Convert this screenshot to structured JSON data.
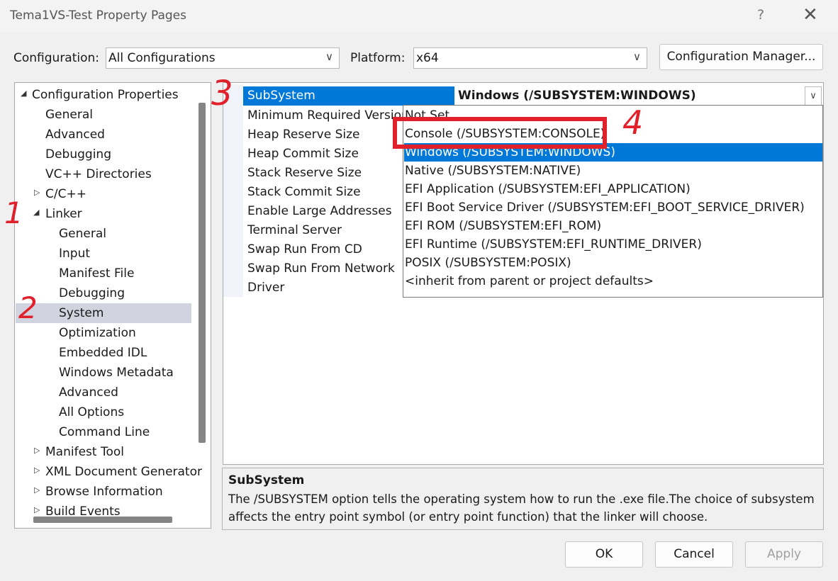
{
  "window": {
    "title": "Tema1VS-Test Property Pages",
    "help_icon": "?",
    "close_icon": "✕"
  },
  "config_bar": {
    "configuration_label": "Configuration:",
    "configuration_value": "All Configurations",
    "platform_label": "Platform:",
    "platform_value": "x64",
    "manager_button": "Configuration Manager..."
  },
  "tree": {
    "root": "Configuration Properties",
    "general": "General",
    "advanced": "Advanced",
    "debugging": "Debugging",
    "vc_dirs": "VC++ Directories",
    "cpp": "C/C++",
    "linker": "Linker",
    "linker_children": [
      "General",
      "Input",
      "Manifest File",
      "Debugging",
      "System",
      "Optimization",
      "Embedded IDL",
      "Windows Metadata",
      "Advanced",
      "All Options",
      "Command Line"
    ],
    "manifest_tool": "Manifest Tool",
    "xml_doc": "XML Document Generator",
    "browse_info": "Browse Information",
    "build_events": "Build Events"
  },
  "properties": {
    "selected_name": "SubSystem",
    "selected_value": "Windows (/SUBSYSTEM:WINDOWS)",
    "rows": [
      "Minimum Required Version",
      "Heap Reserve Size",
      "Heap Commit Size",
      "Stack Reserve Size",
      "Stack Commit Size",
      "Enable Large Addresses",
      "Terminal Server",
      "Swap Run From CD",
      "Swap Run From Network",
      "Driver"
    ]
  },
  "dropdown": {
    "options": [
      "Not Set",
      "Console (/SUBSYSTEM:CONSOLE)",
      "Windows (/SUBSYSTEM:WINDOWS)",
      "Native (/SUBSYSTEM:NATIVE)",
      "EFI Application (/SUBSYSTEM:EFI_APPLICATION)",
      "EFI Boot Service Driver (/SUBSYSTEM:EFI_BOOT_SERVICE_DRIVER)",
      "EFI ROM (/SUBSYSTEM:EFI_ROM)",
      "EFI Runtime (/SUBSYSTEM:EFI_RUNTIME_DRIVER)",
      "POSIX (/SUBSYSTEM:POSIX)",
      "<inherit from parent or project defaults>"
    ],
    "selected_index": 2
  },
  "description": {
    "title": "SubSystem",
    "text_line1": "The /SUBSYSTEM option tells the operating system how to run the .exe file.The choice of subsystem",
    "text_line2": "affects the entry point symbol (or entry point function) that the linker will choose."
  },
  "buttons": {
    "ok": "OK",
    "cancel": "Cancel",
    "apply": "Apply"
  },
  "annotations": {
    "n1": "1",
    "n2": "2",
    "n3": "3",
    "n4": "4",
    "color": "#e0202a"
  }
}
